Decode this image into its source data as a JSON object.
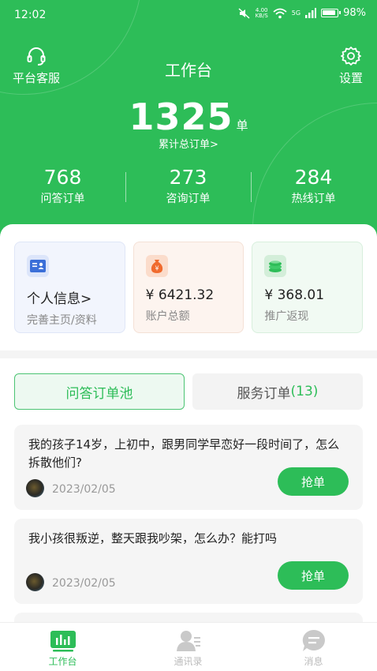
{
  "status_bar": {
    "time": "12:02",
    "net_speed": "4.00",
    "net_unit": "KB/S",
    "signal": "5G",
    "battery": "98%"
  },
  "header": {
    "title": "工作台",
    "left_button": {
      "label": "平台客服",
      "icon": "headset-icon"
    },
    "right_button": {
      "label": "设置",
      "icon": "gear-icon"
    },
    "total_orders": "1325",
    "total_unit": "单",
    "total_link": "累计总订单>",
    "stats": [
      {
        "value": "768",
        "label": "问答订单"
      },
      {
        "value": "273",
        "label": "咨询订单"
      },
      {
        "value": "284",
        "label": "热线订单"
      }
    ]
  },
  "cards": [
    {
      "icon": "id-card-icon",
      "value": "个人信息>",
      "sub": "完善主页/资料",
      "accent": "#3b6fd8"
    },
    {
      "icon": "money-bag-icon",
      "value": "¥ 6421.32",
      "sub": "账户总额",
      "accent": "#f06a2d"
    },
    {
      "icon": "coin-stack-icon",
      "value": "¥ 368.01",
      "sub": "推广返现",
      "accent": "#2dbd58"
    }
  ],
  "tabs": {
    "active_label": "问答订单池",
    "inactive_label": "服务订单",
    "inactive_count": "(13)"
  },
  "orders": [
    {
      "text": "我的孩子14岁，上初中，跟男同学早恋好一段时间了，怎么拆散他们?",
      "date": "2023/02/05",
      "button": "抢单"
    },
    {
      "text": "我小孩很叛逆，整天跟我吵架，怎么办？能打吗",
      "date": "2023/02/05",
      "button": "抢单"
    }
  ],
  "bottom_nav": [
    {
      "label": "工作台",
      "icon": "dashboard-icon",
      "active": true
    },
    {
      "label": "通讯录",
      "icon": "contacts-icon",
      "active": false
    },
    {
      "label": "消息",
      "icon": "message-icon",
      "active": false
    }
  ],
  "colors": {
    "brand_green": "#2dbd58",
    "text_dark": "#222222",
    "text_gray": "#888888"
  }
}
